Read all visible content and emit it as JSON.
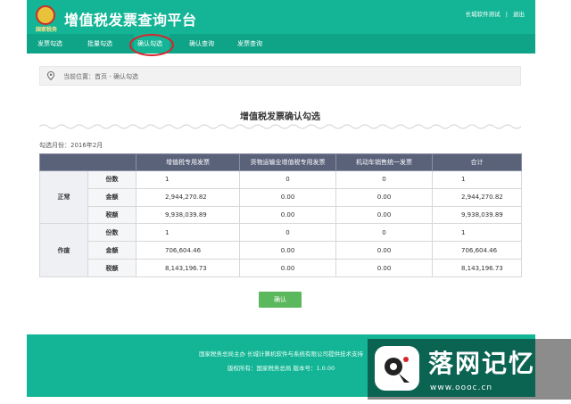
{
  "header": {
    "logo_text": "国家税务",
    "title": "增值税发票查询平台",
    "user": "长城软件测试",
    "logout": "退出"
  },
  "nav": {
    "items": [
      {
        "label": "发票勾选"
      },
      {
        "label": "批量勾选"
      },
      {
        "label": "确认勾选"
      },
      {
        "label": "确认查询"
      },
      {
        "label": "发票查询"
      }
    ]
  },
  "breadcrumb": {
    "text": "当前位置：首页 - 确认勾选"
  },
  "section": {
    "title": "增值税发票确认勾选"
  },
  "period": {
    "label": "勾选月份：2016年2月"
  },
  "table": {
    "headers": [
      "增值税专用发票",
      "货物运输业增值税专用发票",
      "机动车销售统一发票",
      "合计"
    ],
    "groups": [
      {
        "name": "正常",
        "rows": [
          {
            "label": "份数",
            "values": [
              "1",
              "0",
              "0",
              "1"
            ]
          },
          {
            "label": "金额",
            "values": [
              "2,944,270.82",
              "0.00",
              "0.00",
              "2,944,270.82"
            ]
          },
          {
            "label": "税额",
            "values": [
              "9,938,039.89",
              "0.00",
              "0.00",
              "9,938,039.89"
            ]
          }
        ]
      },
      {
        "name": "作废",
        "rows": [
          {
            "label": "份数",
            "values": [
              "1",
              "0",
              "0",
              "1"
            ]
          },
          {
            "label": "金额",
            "values": [
              "706,604.46",
              "0.00",
              "0.00",
              "706,604.46"
            ]
          },
          {
            "label": "税额",
            "values": [
              "8,143,196.73",
              "0.00",
              "0.00",
              "8,143,196.73"
            ]
          }
        ]
      }
    ]
  },
  "confirm_button": "确认",
  "footer": {
    "line1": "国家税务总局主办 长城计算机软件与系统有限公司提供技术支持",
    "line2": "版权所有：国家税务总局 版本号：1.0.00"
  },
  "watermark": {
    "title": "落网记忆",
    "url": "www.oooc.cn"
  },
  "colors": {
    "brand_green": "#14b596",
    "table_header": "#5a627a",
    "confirm_green": "#5cb85c",
    "highlight_red": "#d9232c"
  }
}
